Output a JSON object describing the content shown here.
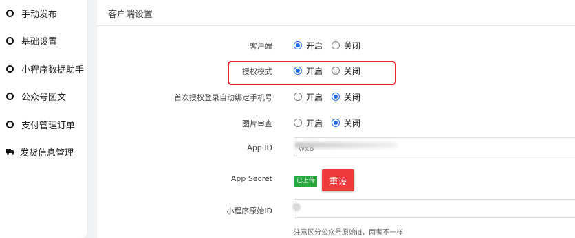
{
  "sidebar": {
    "items": [
      {
        "label": "手动发布",
        "icon": "ring-icon"
      },
      {
        "label": "基础设置",
        "icon": "ring-icon"
      },
      {
        "label": "小程序数据助手",
        "icon": "ring-icon"
      },
      {
        "label": "公众号图文",
        "icon": "ring-icon"
      },
      {
        "label": "支付管理订单",
        "icon": "ring-icon"
      },
      {
        "label": "发货信息管理",
        "icon": "truck-icon"
      }
    ]
  },
  "panel": {
    "title": "客户端设置"
  },
  "form": {
    "client": {
      "label": "客户端",
      "options": [
        "开启",
        "关闭"
      ],
      "selected": "开启"
    },
    "auth_mode": {
      "label": "授权模式",
      "options": [
        "开启",
        "关闭"
      ],
      "selected": "开启"
    },
    "first_bind_phone": {
      "label": "首次授权登录自动绑定手机号",
      "options": [
        "开启",
        "关闭"
      ],
      "selected": "关闭"
    },
    "image_review": {
      "label": "图片审查",
      "options": [
        "开启",
        "关闭"
      ],
      "selected": "关闭"
    },
    "app_id": {
      "label": "App ID",
      "value": "wx8"
    },
    "app_secret": {
      "label": "App Secret",
      "badge": "已上传",
      "reset_label": "重设"
    },
    "original_id": {
      "label": "小程序原始ID",
      "value": "",
      "hint": "注意区分公众号原始id，两者不一样"
    }
  },
  "colors": {
    "accent": "#1e6ff5",
    "highlight": "#e8242f",
    "reset": "#ef3b3b",
    "badge": "#25a83c"
  }
}
